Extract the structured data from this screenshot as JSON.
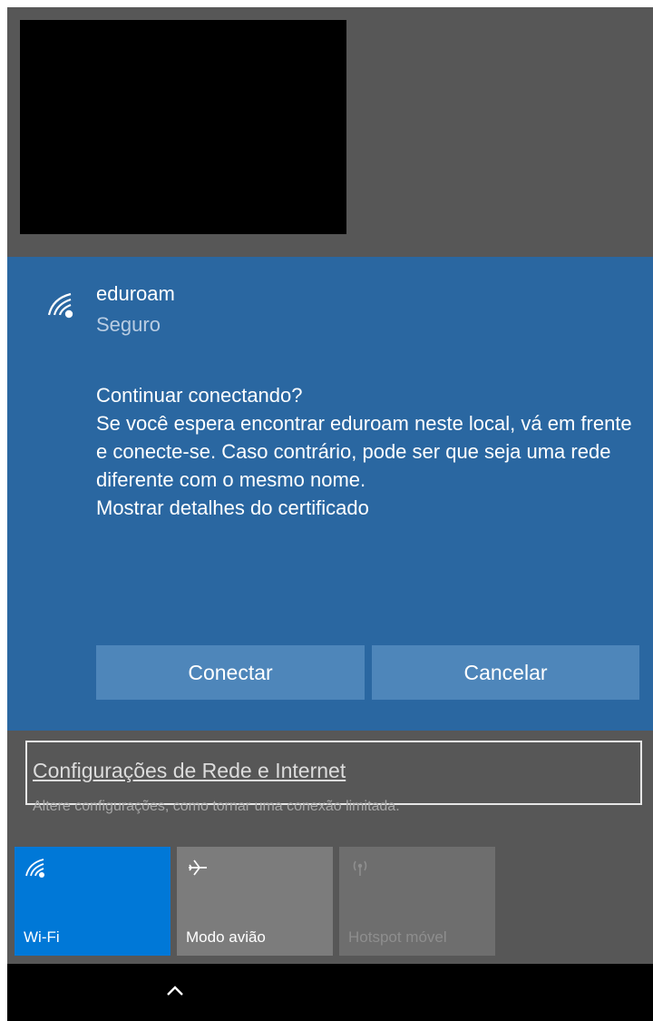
{
  "network": {
    "name": "eduroam",
    "status": "Seguro",
    "icon": "wifi-secure-icon"
  },
  "prompt": {
    "question": "Continuar conectando?",
    "body": "Se você espera encontrar eduroam neste local, vá em frente e conecte-se. Caso contrário, pode ser que seja uma rede diferente com o mesmo nome.",
    "cert_link": "Mostrar detalhes do certificado"
  },
  "buttons": {
    "connect": "Conectar",
    "cancel": "Cancelar"
  },
  "settings": {
    "link": "Configurações de Rede e Internet",
    "subtitle": "Altere configurações, como tornar uma conexão limitada."
  },
  "quick_actions": [
    {
      "label": "Wi-Fi",
      "icon": "wifi-icon",
      "active": true
    },
    {
      "label": "Modo avião",
      "icon": "airplane-icon",
      "active": false
    },
    {
      "label": "Hotspot móvel",
      "icon": "hotspot-icon",
      "active": false,
      "disabled": true
    }
  ],
  "taskbar": {
    "icon": "chevron-up-icon"
  },
  "colors": {
    "panel_blue": "#2a67a1",
    "button_blue": "#4e86ba",
    "tile_active": "#0078d7",
    "background_gray": "#575757"
  }
}
